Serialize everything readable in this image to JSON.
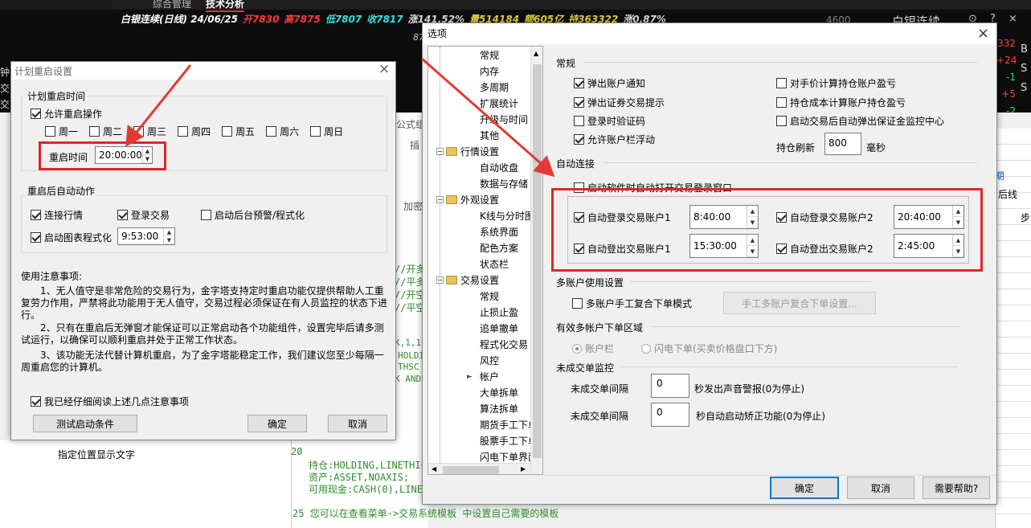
{
  "bg": {
    "top_tabs": [
      "综合管理",
      "技术分析"
    ],
    "ticker": "白银连续(日线) 24/06/25",
    "open": "开7830",
    "high": "高7875",
    "low": "低7807",
    "close": "收7817",
    "change": "涨141.52%",
    "volume": "量514184",
    "amount": "额605亿",
    "hold": "持363322",
    "extra": "涨0.87%",
    "right_title": "白银连续",
    "side_left": [
      "钟",
      "交",
      "交"
    ],
    "right_nums": [
      "332",
      "+24",
      "-1",
      "+5",
      "-2"
    ],
    "right_letters": [
      "B",
      "S",
      "S"
    ],
    "mid_labels": [
      "公式组",
      "插",
      "加密"
    ],
    "code_lines": [
      "//开多",
      "//平多",
      "//开空",
      "//平空",
      "K,1,1",
      "HOLDI",
      "THSC",
      "K AND",
      "20",
      "持仓:HOLDING,LINETHIC",
      "资产:ASSET,NOAXIS;",
      "可用现金:CASH(0),LINE",
      "25 您可以在查看菜单->交易系统模板 中设置自己需要的模板"
    ],
    "right_col_labels": [
      "期",
      "后线",
      "步"
    ],
    "left_bottom_item": "指定位置显示文字",
    "num_87": "87",
    "num_4600": "4600"
  },
  "restart_dialog": {
    "title": "计划重启设置",
    "group1_title": "计划重启时间",
    "allow_restart": "允许重启操作",
    "weekdays": [
      "周一",
      "周二",
      "周三",
      "周四",
      "周五",
      "周六",
      "周日"
    ],
    "restart_time_label": "重启时间",
    "restart_time_value": "20:00:00",
    "group2_title": "重启后自动动作",
    "connect_market": "连接行情",
    "login_trade": "登录交易",
    "start_alert": "启动后台预警/程式化",
    "start_chart_prog": "启动图表程式化",
    "chart_prog_time": "9:53:00",
    "notes_title": "使用注意事项:",
    "note1": "1、无人值守是非常危险的交易行为，金字塔支持定时重启功能仅提供帮助人工重复劳力作用，严禁将此功能用于无人值守，交易过程必须保证在有人员监控的状态下进行。",
    "note2": "2、只有在重启后无弹窗才能保证可以正常启动各个功能组件，设置完毕后请多测试运行，以确保可以顺利重启并处于正常工作状态。",
    "note3": "3、该功能无法代替计算机重启，为了金字塔能稳定工作，我们建议您至少每隔一周重启您的计算机。",
    "read_confirm": "我已经仔细阅读上述几点注意事项",
    "test_button": "测试启动条件",
    "ok_button": "确定",
    "cancel_button": "取消"
  },
  "options_dialog": {
    "title": "选项",
    "tree": [
      {
        "label": "常规",
        "level": 2
      },
      {
        "label": "内存",
        "level": 2
      },
      {
        "label": "多周期",
        "level": 2
      },
      {
        "label": "扩展统计",
        "level": 2
      },
      {
        "label": "升级与时间",
        "level": 2
      },
      {
        "label": "其他",
        "level": 2
      },
      {
        "label": "行情设置",
        "level": 1
      },
      {
        "label": "自动收盘",
        "level": 2
      },
      {
        "label": "数据与存储",
        "level": 2
      },
      {
        "label": "外观设置",
        "level": 1
      },
      {
        "label": "K线与分时图",
        "level": 2
      },
      {
        "label": "系统界面",
        "level": 2
      },
      {
        "label": "配色方案",
        "level": 2
      },
      {
        "label": "状态栏",
        "level": 2
      },
      {
        "label": "交易设置",
        "level": 1
      },
      {
        "label": "常规",
        "level": 2
      },
      {
        "label": "止损止盈",
        "level": 2
      },
      {
        "label": "追单撤单",
        "level": 2
      },
      {
        "label": "程式化交易",
        "level": 2
      },
      {
        "label": "风控",
        "level": 2
      },
      {
        "label": "帐户",
        "level": 2
      },
      {
        "label": "大单拆单",
        "level": 2
      },
      {
        "label": "算法拆单",
        "level": 2
      },
      {
        "label": "期货手工下单",
        "level": 2
      },
      {
        "label": "股票手工下单",
        "level": 2
      },
      {
        "label": "闪电下单界面",
        "level": 2
      }
    ],
    "general_title": "常规",
    "popup_account_notice": "弹出账户通知",
    "popup_broker_tip": "弹出证券交易提示",
    "login_verify": "登录时验证码",
    "allow_float": "允许账户栏浮动",
    "counter_price_pnl": "对手价计算持仓账户盈亏",
    "cost_pnl": "持仓成本计算账户持仓盈亏",
    "popup_margin": "启动交易后自动弹出保证金监控中心",
    "refresh_label": "持仓刷新",
    "refresh_value": "800",
    "refresh_unit": "毫秒",
    "auto_connect_title": "自动连接",
    "auto_open_login": "启动软件时自动打开交易登录窗口",
    "auto_login1": "自动登录交易账户1",
    "auto_login1_time": "8:40:00",
    "auto_login2": "自动登录交易账户2",
    "auto_login2_time": "20:40:00",
    "auto_logout1": "自动登出交易账户1",
    "auto_logout1_time": "15:30:00",
    "auto_logout2": "自动登出交易账户2",
    "auto_logout2_time": "2:45:00",
    "multi_title": "多账户使用设置",
    "multi_manual": "多账户手工复合下单模式",
    "multi_button": "手工多账户复合下单设置...",
    "area_title": "有效多帐户下单区域",
    "radio_account_bar": "账户栏",
    "radio_flash": "闪电下单(买卖价格盘口下方)",
    "unfilled_title": "未成交单监控",
    "unfilled_interval_label": "未成交单间隔",
    "unfilled_sound_value": "0",
    "unfilled_sound_desc": "秒发出声音警报(0为停止)",
    "unfilled_auto_value": "0",
    "unfilled_auto_desc": "秒自动启动矫正功能(0为停止)",
    "ok_button": "确定",
    "cancel_button": "取消",
    "help_button": "需要帮助?"
  },
  "colors": {
    "highlight_red": "#e3242b",
    "arrow_red": "#e53935",
    "primary_border": "#0078d7"
  }
}
